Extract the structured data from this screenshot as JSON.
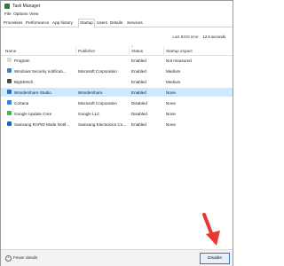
{
  "window": {
    "title": "Task Manager"
  },
  "menu": [
    "File",
    "Options",
    "View"
  ],
  "tabs": [
    "Processes",
    "Performance",
    "App history",
    "Startup",
    "Users",
    "Details",
    "Services"
  ],
  "active_tab": "Startup",
  "bios": {
    "label": "Last BIOS time:",
    "value": "12.5 seconds"
  },
  "columns": {
    "name": "Name",
    "publisher": "Publisher",
    "status": "Status",
    "impact": "Startup impact"
  },
  "rows": [
    {
      "name": "Program",
      "publisher": "",
      "status": "Enabled",
      "impact": "Not measured",
      "icon": "blank-app-icon",
      "color": "#d9d9d9"
    },
    {
      "name": "Windows Security notificati...",
      "publisher": "Microsoft Corporation",
      "status": "Enabled",
      "impact": "Medium",
      "icon": "shield-icon",
      "color": "#3a7bd5"
    },
    {
      "name": "BigStretch",
      "publisher": "",
      "status": "Enabled",
      "impact": "Medium",
      "icon": "bigstretch-icon",
      "color": "#4a4a4a"
    },
    {
      "name": "Wondershare Studio",
      "publisher": "Wondershare",
      "status": "Enabled",
      "impact": "None",
      "icon": "wondershare-icon",
      "color": "#2f6fd6"
    },
    {
      "name": "Cortana",
      "publisher": "Microsoft Corporation",
      "status": "Disabled",
      "impact": "None",
      "icon": "cortana-icon",
      "color": "#1e88e5"
    },
    {
      "name": "Google Update Core",
      "publisher": "Google LLC",
      "status": "Disabled",
      "impact": "None",
      "icon": "google-update-icon",
      "color": "#4caf50"
    },
    {
      "name": "Samsung RAPID Mode Notif...",
      "publisher": "Samsung Electronics Co...",
      "status": "Enabled",
      "impact": "None",
      "icon": "samsung-icon",
      "color": "#1565c0"
    }
  ],
  "selected_row": 3,
  "footer": {
    "fewer_details": "Fewer details",
    "disable": "Disable"
  },
  "accent": "#cde8ff",
  "arrow_color": "#e53935"
}
